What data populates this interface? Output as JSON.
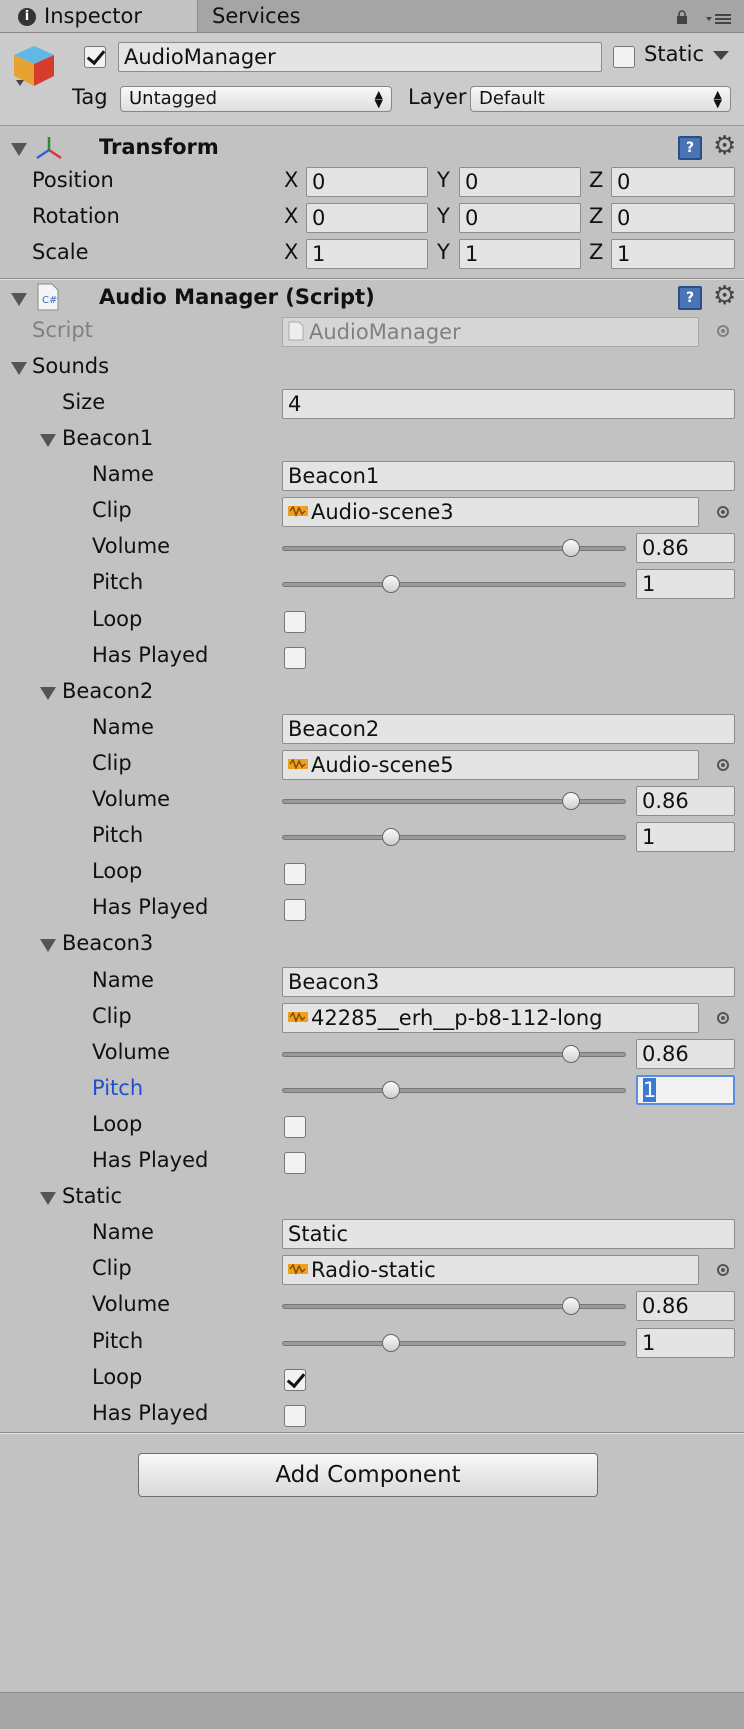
{
  "tabs": {
    "inspector": "Inspector",
    "services": "Services"
  },
  "gameobject": {
    "name": "AudioManager",
    "active": true,
    "static_label": "Static",
    "static": false,
    "tag_label": "Tag",
    "tag_value": "Untagged",
    "layer_label": "Layer",
    "layer_value": "Default"
  },
  "transform": {
    "title": "Transform",
    "position_label": "Position",
    "rotation_label": "Rotation",
    "scale_label": "Scale",
    "axes": {
      "x": "X",
      "y": "Y",
      "z": "Z"
    },
    "position": {
      "x": "0",
      "y": "0",
      "z": "0"
    },
    "rotation": {
      "x": "0",
      "y": "0",
      "z": "0"
    },
    "scale": {
      "x": "1",
      "y": "1",
      "z": "1"
    }
  },
  "audio_manager": {
    "title": "Audio Manager (Script)",
    "script_label": "Script",
    "script_value": "AudioManager",
    "sounds_label": "Sounds",
    "size_label": "Size",
    "size_value": "4",
    "field_labels": {
      "name": "Name",
      "clip": "Clip",
      "volume": "Volume",
      "pitch": "Pitch",
      "loop": "Loop",
      "has_played": "Has Played"
    },
    "sounds": [
      {
        "header": "Beacon1",
        "name": "Beacon1",
        "clip": "Audio-scene3",
        "volume": "0.86",
        "volume_fraction": 0.86,
        "pitch": "1",
        "loop": false,
        "has_played": false
      },
      {
        "header": "Beacon2",
        "name": "Beacon2",
        "clip": "Audio-scene5",
        "volume": "0.86",
        "volume_fraction": 0.86,
        "pitch": "1",
        "loop": false,
        "has_played": false
      },
      {
        "header": "Beacon3",
        "name": "Beacon3",
        "clip": "42285__erh__p-b8-112-long",
        "volume": "0.86",
        "volume_fraction": 0.86,
        "pitch": "1",
        "loop": false,
        "has_played": false
      },
      {
        "header": "Static",
        "name": "Static",
        "clip": "Radio-static",
        "volume": "0.86",
        "volume_fraction": 0.86,
        "pitch": "1",
        "loop": true,
        "has_played": false
      }
    ]
  },
  "add_component": "Add Component",
  "colors": {
    "background": "#c2c2c2",
    "focus_blue": "#3b79d6",
    "label_focus": "#1f4fd1"
  }
}
